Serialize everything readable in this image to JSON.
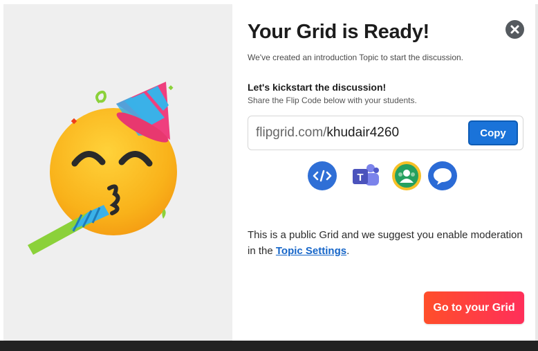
{
  "modal": {
    "title": "Your Grid is Ready!",
    "subtitle": "We've created an introduction Topic to start the discussion.",
    "kickstart_heading": "Let's kickstart the discussion!",
    "kickstart_sub": "Share the Flip Code below with your students.",
    "code_prefix": "flipgrid.com/",
    "code_value": "khudair4260",
    "copy_label": "Copy",
    "share_icons": [
      "embed-code-icon",
      "microsoft-teams-icon",
      "google-classroom-icon",
      "remind-icon"
    ],
    "notice_text": "This is a public Grid and we suggest you enable moderation in the ",
    "notice_link": "Topic Settings",
    "notice_end": ".",
    "cta_label": "Go to your Grid",
    "close_icon": "close-icon",
    "illustration": "party-face-emoji"
  },
  "colors": {
    "copy_button": "#1a73d9",
    "cta_gradient_start": "#ff4e2a",
    "cta_gradient_end": "#ff2f5a",
    "link": "#1565c8",
    "left_panel": "#efefef"
  }
}
